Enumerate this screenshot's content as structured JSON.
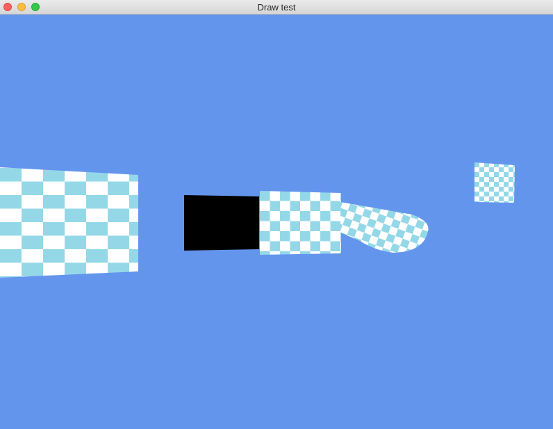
{
  "window": {
    "title": "Draw test"
  },
  "colors": {
    "clear_color": "#6495ED",
    "checker_light": "#FFFFFF",
    "checker_dark": "#94D8E8",
    "untextured": "#000000"
  },
  "scene": {
    "objects": [
      "left-checkered-plane",
      "black-untextured-quad",
      "center-checkered-quad",
      "checkered-tube",
      "small-checkered-quad"
    ]
  }
}
